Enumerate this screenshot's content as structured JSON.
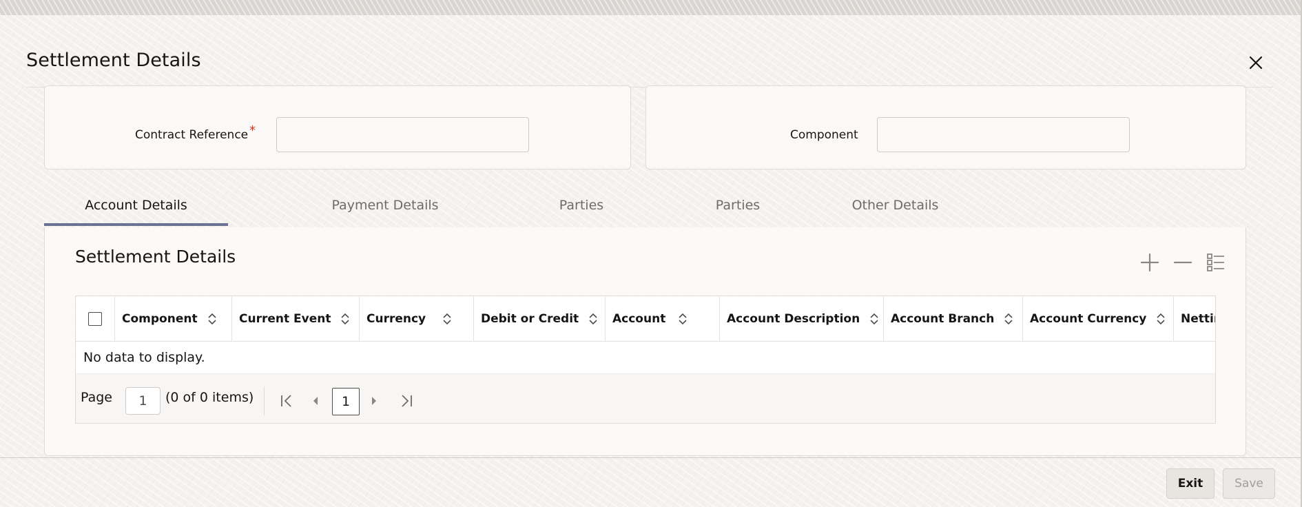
{
  "dialog": {
    "title": "Settlement Details"
  },
  "header_fields": {
    "contract_reference": {
      "label": "Contract Reference",
      "required_mark": "*",
      "value": ""
    },
    "component": {
      "label": "Component",
      "value": ""
    }
  },
  "tabs": [
    {
      "label": "Account Details",
      "active": true
    },
    {
      "label": "Payment Details",
      "active": false
    },
    {
      "label": "Parties",
      "active": false
    },
    {
      "label": "Parties",
      "active": false
    },
    {
      "label": "Other Details",
      "active": false
    }
  ],
  "section": {
    "title": "Settlement Details",
    "toolbar_icons": [
      "add-icon",
      "remove-icon",
      "column-list-icon"
    ]
  },
  "grid": {
    "columns": [
      "Component",
      "Current Event",
      "Currency",
      "Debit or Credit",
      "Account",
      "Account Description",
      "Account Branch",
      "Account Currency",
      "Nettin"
    ],
    "empty_message": "No data to display."
  },
  "pager": {
    "label": "Page",
    "page_input": "1",
    "items_text": "(0 of 0 items)",
    "current_page": "1"
  },
  "footer": {
    "exit_label": "Exit",
    "save_label": "Save"
  },
  "colors": {
    "active_tab_underline": "#6b7192",
    "required": "#c23b28",
    "text": "#161513",
    "muted": "#6f6b66"
  }
}
